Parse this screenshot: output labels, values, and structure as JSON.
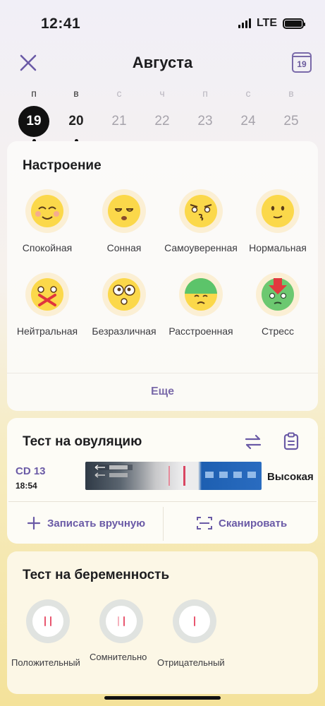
{
  "status_bar": {
    "time": "12:41",
    "network": "LTE"
  },
  "header": {
    "title": "Августа",
    "calendar_day": "19"
  },
  "week": [
    {
      "letter": "п",
      "num": "19",
      "state": "selected",
      "dot": true
    },
    {
      "letter": "в",
      "num": "20",
      "state": "active",
      "dot": true
    },
    {
      "letter": "с",
      "num": "21",
      "state": "future",
      "dot": false
    },
    {
      "letter": "ч",
      "num": "22",
      "state": "future",
      "dot": false
    },
    {
      "letter": "п",
      "num": "23",
      "state": "future",
      "dot": false
    },
    {
      "letter": "с",
      "num": "24",
      "state": "future",
      "dot": false
    },
    {
      "letter": "в",
      "num": "25",
      "state": "future",
      "dot": false
    }
  ],
  "mood": {
    "title": "Настроение",
    "items": [
      {
        "label": "Спокойная",
        "icon": "calm-face-icon"
      },
      {
        "label": "Сонная",
        "icon": "sleepy-face-icon"
      },
      {
        "label": "Самоуверенная",
        "icon": "confident-face-icon"
      },
      {
        "label": "Нормальная",
        "icon": "normal-face-icon"
      },
      {
        "label": "Нейтральная",
        "icon": "neutral-face-icon"
      },
      {
        "label": "Безразличная",
        "icon": "indifferent-face-icon"
      },
      {
        "label": "Расстроенная",
        "icon": "upset-face-icon"
      },
      {
        "label": "Стресс",
        "icon": "stress-face-icon"
      }
    ],
    "more": "Еще"
  },
  "ovulation": {
    "title": "Тест на овуляцию",
    "cycle_day": "CD 13",
    "time": "18:54",
    "level": "Высокая",
    "manual": "Записать вручную",
    "scan": "Сканировать"
  },
  "pregnancy": {
    "title": "Тест на беременность",
    "options": [
      "Положительный",
      "Сомнительно",
      "Отрицательный"
    ]
  },
  "colors": {
    "accent": "#7a6aa9",
    "accent_text": "#6a5aa6",
    "test_line": "#e8566f"
  }
}
